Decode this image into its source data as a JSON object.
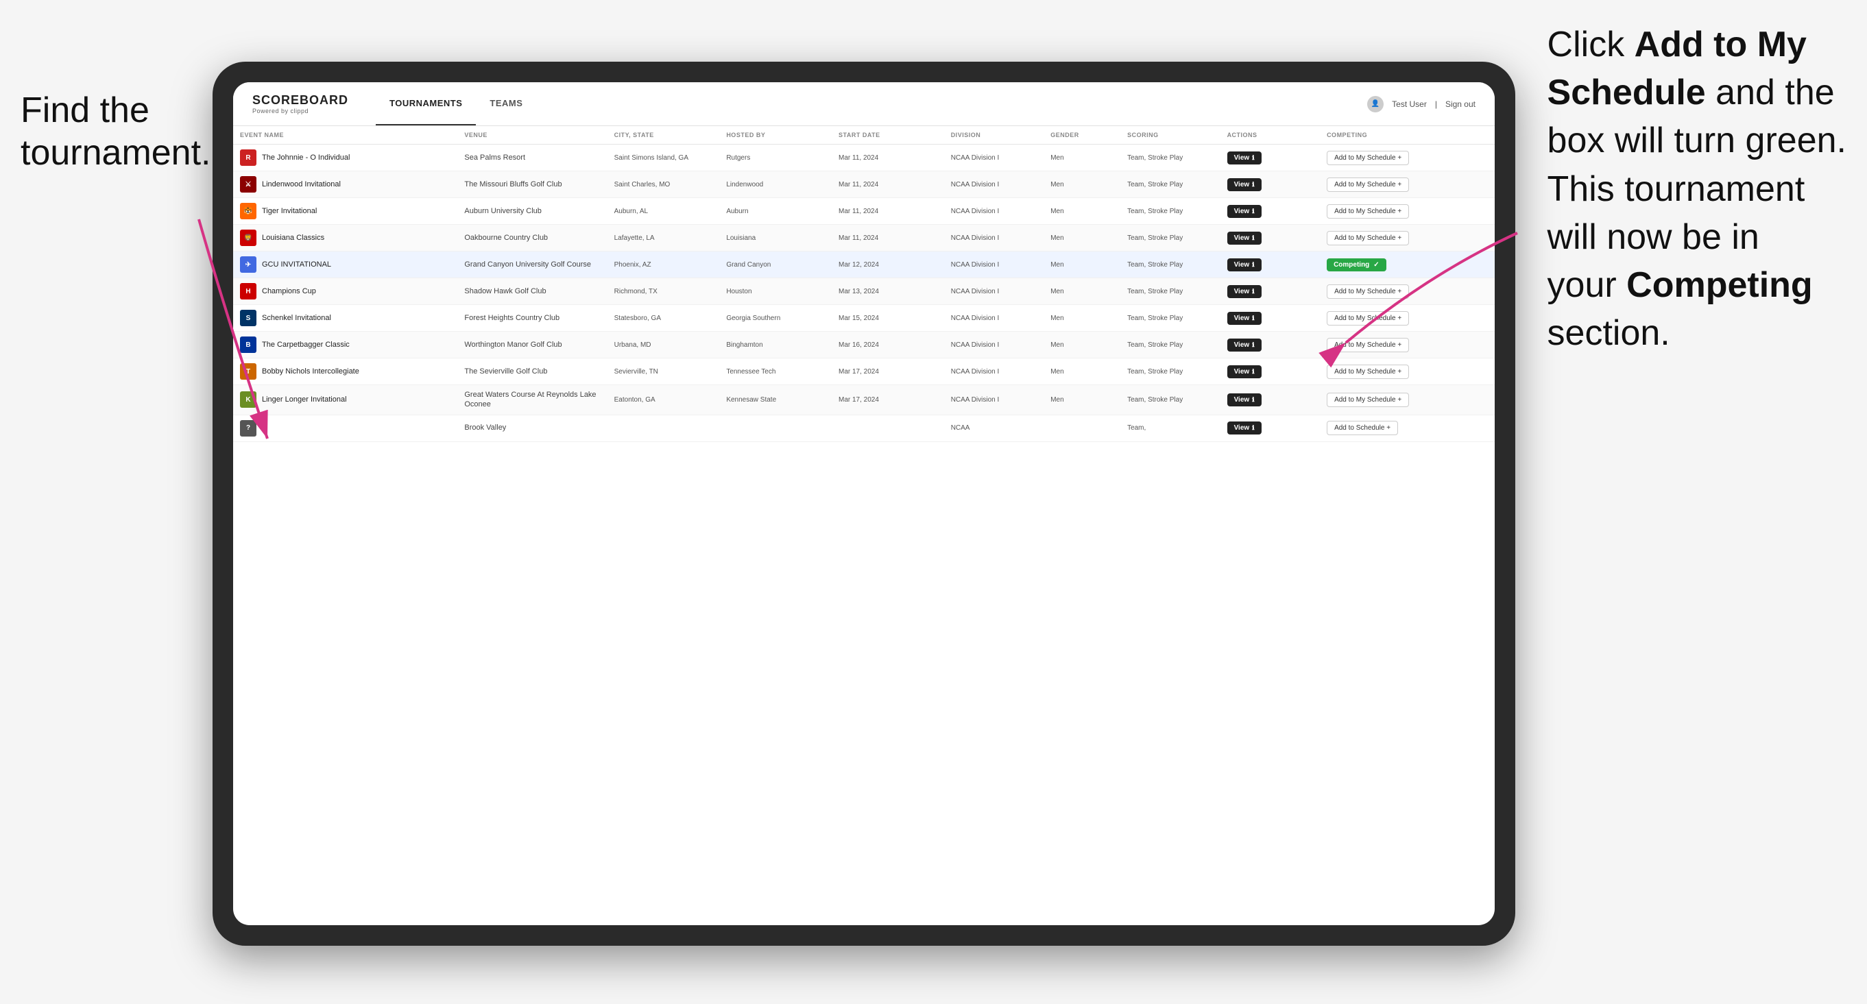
{
  "instructions": {
    "left": "Find the\ntournament.",
    "right_part1": "Click ",
    "right_bold1": "Add to My\nSchedule",
    "right_part2": " and the\nbox will turn green.\nThis tournament\nwill now be in\nyour ",
    "right_bold2": "Competing",
    "right_part3": "\nsection."
  },
  "header": {
    "logo": "SCOREBOARD",
    "logo_sub": "Powered by clippd",
    "nav": [
      "TOURNAMENTS",
      "TEAMS"
    ],
    "active_nav": "TOURNAMENTS",
    "user": "Test User",
    "signout": "Sign out"
  },
  "table": {
    "columns": [
      "EVENT NAME",
      "VENUE",
      "CITY, STATE",
      "HOSTED BY",
      "START DATE",
      "DIVISION",
      "GENDER",
      "SCORING",
      "ACTIONS",
      "COMPETING"
    ],
    "rows": [
      {
        "logo_color": "#cc2222",
        "logo_letter": "R",
        "event": "The Johnnie - O Individual",
        "venue": "Sea Palms Resort",
        "city": "Saint Simons Island, GA",
        "hosted": "Rutgers",
        "date": "Mar 11, 2024",
        "division": "NCAA Division I",
        "gender": "Men",
        "scoring": "Team, Stroke Play",
        "action": "View",
        "competing_type": "add",
        "competing_label": "Add to My Schedule +"
      },
      {
        "logo_color": "#8B0000",
        "logo_letter": "L",
        "event": "Lindenwood Invitational",
        "venue": "The Missouri Bluffs Golf Club",
        "city": "Saint Charles, MO",
        "hosted": "Lindenwood",
        "date": "Mar 11, 2024",
        "division": "NCAA Division I",
        "gender": "Men",
        "scoring": "Team, Stroke Play",
        "action": "View",
        "competing_type": "add",
        "competing_label": "Add to My Schedule +"
      },
      {
        "logo_color": "#FF6600",
        "logo_letter": "T",
        "event": "Tiger Invitational",
        "venue": "Auburn University Club",
        "city": "Auburn, AL",
        "hosted": "Auburn",
        "date": "Mar 11, 2024",
        "division": "NCAA Division I",
        "gender": "Men",
        "scoring": "Team, Stroke Play",
        "action": "View",
        "competing_type": "add",
        "competing_label": "Add to My Schedule +"
      },
      {
        "logo_color": "#cc0000",
        "logo_letter": "La",
        "event": "Louisiana Classics",
        "venue": "Oakbourne Country Club",
        "city": "Lafayette, LA",
        "hosted": "Louisiana",
        "date": "Mar 11, 2024",
        "division": "NCAA Division I",
        "gender": "Men",
        "scoring": "Team, Stroke Play",
        "action": "View",
        "competing_type": "add",
        "competing_label": "Add to My Schedule +"
      },
      {
        "logo_color": "#4169e1",
        "logo_letter": "G",
        "event": "GCU INVITATIONAL",
        "venue": "Grand Canyon University Golf Course",
        "city": "Phoenix, AZ",
        "hosted": "Grand Canyon",
        "date": "Mar 12, 2024",
        "division": "NCAA Division I",
        "gender": "Men",
        "scoring": "Team, Stroke Play",
        "action": "View",
        "competing_type": "competing",
        "competing_label": "Competing ✓",
        "highlighted": true
      },
      {
        "logo_color": "#cc0000",
        "logo_letter": "H",
        "event": "Champions Cup",
        "venue": "Shadow Hawk Golf Club",
        "city": "Richmond, TX",
        "hosted": "Houston",
        "date": "Mar 13, 2024",
        "division": "NCAA Division I",
        "gender": "Men",
        "scoring": "Team, Stroke Play",
        "action": "View",
        "competing_type": "add",
        "competing_label": "Add to My Schedule +"
      },
      {
        "logo_color": "#003366",
        "logo_letter": "S",
        "event": "Schenkel Invitational",
        "venue": "Forest Heights Country Club",
        "city": "Statesboro, GA",
        "hosted": "Georgia Southern",
        "date": "Mar 15, 2024",
        "division": "NCAA Division I",
        "gender": "Men",
        "scoring": "Team, Stroke Play",
        "action": "View",
        "competing_type": "add",
        "competing_label": "Add to My Schedule +"
      },
      {
        "logo_color": "#003399",
        "logo_letter": "B",
        "event": "The Carpetbagger Classic",
        "venue": "Worthington Manor Golf Club",
        "city": "Urbana, MD",
        "hosted": "Binghamton",
        "date": "Mar 16, 2024",
        "division": "NCAA Division I",
        "gender": "Men",
        "scoring": "Team, Stroke Play",
        "action": "View",
        "competing_type": "add",
        "competing_label": "Add to My Schedule +"
      },
      {
        "logo_color": "#cc6600",
        "logo_letter": "TT",
        "event": "Bobby Nichols Intercollegiate",
        "venue": "The Sevierville Golf Club",
        "city": "Sevierville, TN",
        "hosted": "Tennessee Tech",
        "date": "Mar 17, 2024",
        "division": "NCAA Division I",
        "gender": "Men",
        "scoring": "Team, Stroke Play",
        "action": "View",
        "competing_type": "add",
        "competing_label": "Add to My Schedule +"
      },
      {
        "logo_color": "#ffcc00",
        "logo_letter": "K",
        "event": "Linger Longer Invitational",
        "venue": "Great Waters Course At Reynolds Lake Oconee",
        "city": "Eatonton, GA",
        "hosted": "Kennesaw State",
        "date": "Mar 17, 2024",
        "division": "NCAA Division I",
        "gender": "Men",
        "scoring": "Team, Stroke Play",
        "action": "View",
        "competing_type": "add",
        "competing_label": "Add to My Schedule +"
      },
      {
        "logo_color": "#555",
        "logo_letter": "?",
        "event": "",
        "venue": "Brook Valley",
        "city": "",
        "hosted": "",
        "date": "",
        "division": "NCAA",
        "gender": "",
        "scoring": "Team,",
        "action": "View",
        "competing_type": "add",
        "competing_label": "Add to Schedule +"
      }
    ]
  }
}
